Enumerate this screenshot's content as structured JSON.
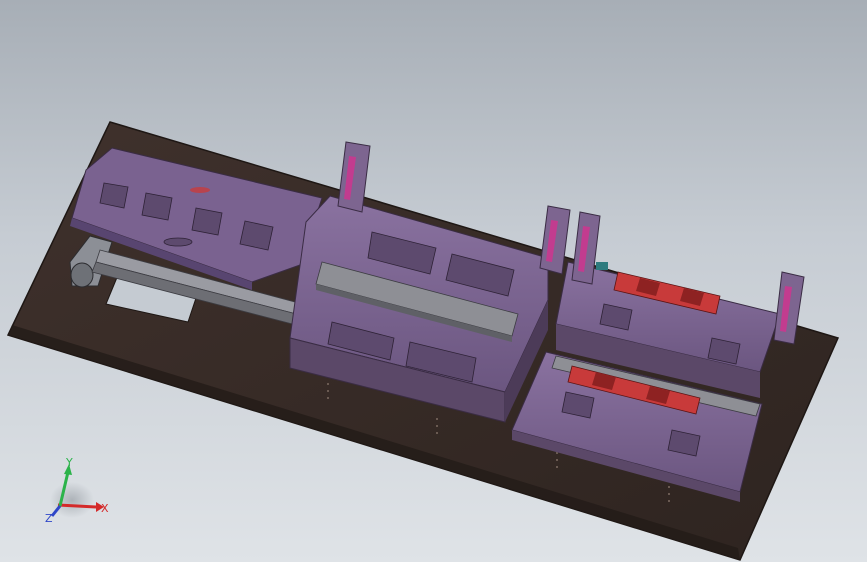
{
  "viewport": {
    "background_top": "#a7aeb6",
    "background_bottom": "#dfe3e7"
  },
  "model": {
    "base_plate_color": "#3a2d29",
    "frame_color": "#7d6590",
    "frame_dark_color": "#5b4868",
    "accent_magenta": "#c23c8f",
    "accent_red": "#c83a3a",
    "rail_color": "#8f9096"
  },
  "triad": {
    "x_label": "X",
    "y_label": "Y",
    "z_label": "Z",
    "x_color": "#d42a2a",
    "y_color": "#2bb34a",
    "z_color": "#2f47c8"
  }
}
